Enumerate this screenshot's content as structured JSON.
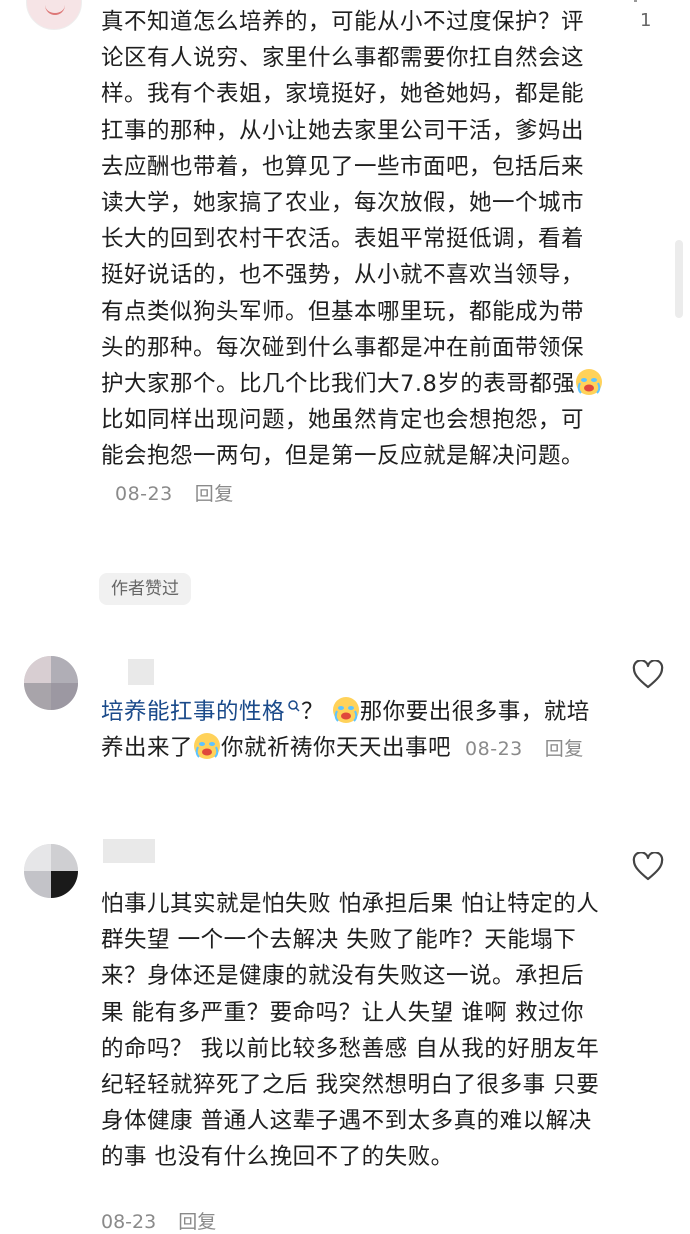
{
  "comments": [
    {
      "like_count": "1",
      "text_a": "真不知道怎么培养的，可能从小不过度保护？评论区有人说穷、家里什么事都需要你扛自然会这样。我有个表姐，家境挺好，她爸她妈，都是能扛事的那种，从小让她去家里公司干活，爹妈出去应酬也带着，也算见了一些市面吧，包括后来读大学，她家搞了农业，每次放假，她一个城市长大的回到农村干农活。表姐平常挺低调，看着挺好说话的，也不强势，从小就不喜欢当领导，有点类似狗头军师。但基本哪里玩，都能成为带头的那种。每次碰到什么事都是冲在前面带领保护大家那个。比几个比我们大7.8岁的表哥都强",
      "text_b": "比如同样出现问题，她虽然肯定也会想抱怨，可能会抱怨一两句，但是第一反应就是解决问题。",
      "date": "08-23",
      "reply": "回复",
      "badge": "作者赞过"
    },
    {
      "link_text": "培养能扛事的性格",
      "text_a": "？",
      "text_b": "那你要出很多事，就培养出来了",
      "text_c": "你就祈祷你天天出事吧",
      "date": "08-23",
      "reply": "回复"
    },
    {
      "text": "怕事儿其实就是怕失败 怕承担后果 怕让特定的人群失望 一个一个去解决 失败了能咋？天能塌下来？身体还是健康的就没有失败这一说。承担后果 能有多严重？要命吗？让人失望 谁啊 救过你的命吗？ 我以前比较多愁善感 自从我的好朋友年纪轻轻就猝死了之后 我突然想明白了很多事 只要身体健康 普通人这辈子遇不到太多真的难以解决的事 也没有什么挽回不了的失败。",
      "date": "08-23",
      "reply": "回复"
    }
  ],
  "icons": {
    "heart": "heart-outline-icon",
    "emoji": "crying-face-emoji",
    "search": "search-icon"
  }
}
